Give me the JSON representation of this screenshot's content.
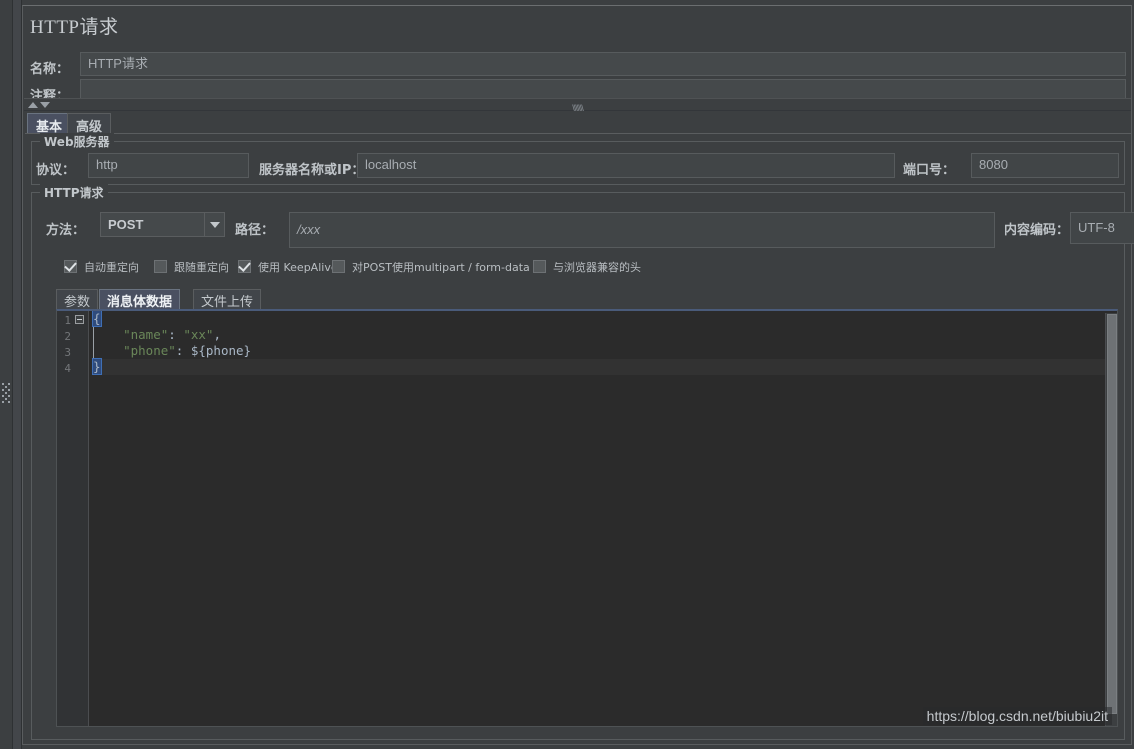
{
  "window": {
    "title": "HTTP请求"
  },
  "header": {
    "name_label": "名称：",
    "name_value": "HTTP请求",
    "comment_label": "注释：",
    "comment_value": ""
  },
  "tabs": [
    {
      "label": "基本",
      "selected": true
    },
    {
      "label": "高级",
      "selected": false
    }
  ],
  "web_server": {
    "group_label": "Web服务器",
    "protocol_label": "协议：",
    "protocol_value": "http",
    "server_label": "服务器名称或IP：",
    "server_value": "localhost",
    "port_label": "端口号：",
    "port_value": "8080"
  },
  "http_request": {
    "group_label": "HTTP请求",
    "method_label": "方法：",
    "method_value": "POST",
    "path_label": "路径：",
    "path_value": "/xxx",
    "encoding_label": "内容编码：",
    "encoding_value": "UTF-8",
    "checkboxes": [
      {
        "label": "自动重定向",
        "checked": true
      },
      {
        "label": "跟随重定向",
        "checked": false
      },
      {
        "label": "使用 KeepAlive",
        "checked": true
      },
      {
        "label": "对POST使用multipart / form-data",
        "checked": false
      },
      {
        "label": "与浏览器兼容的头",
        "checked": false
      }
    ],
    "inner_tabs": [
      {
        "label": "参数",
        "selected": false
      },
      {
        "label": "消息体数据",
        "selected": true
      },
      {
        "label": "文件上传",
        "selected": false
      }
    ]
  },
  "editor": {
    "line_numbers": [
      "1",
      "2",
      "3",
      "4"
    ],
    "lines": [
      {
        "tokens": [
          {
            "t": "{",
            "k": "brace"
          }
        ]
      },
      {
        "tokens": [
          {
            "t": "    ",
            "k": "plain"
          },
          {
            "t": "\"name\"",
            "k": "str"
          },
          {
            "t": ": ",
            "k": "plain"
          },
          {
            "t": "\"xx\"",
            "k": "strg"
          },
          {
            "t": ",",
            "k": "plain"
          }
        ]
      },
      {
        "tokens": [
          {
            "t": "    ",
            "k": "plain"
          },
          {
            "t": "\"phone\"",
            "k": "str"
          },
          {
            "t": ": ",
            "k": "plain"
          },
          {
            "t": "${phone}",
            "k": "plain"
          }
        ]
      },
      {
        "tokens": [
          {
            "t": "}",
            "k": "brace"
          }
        ]
      }
    ],
    "raw_text": "{\n    \"name\": \"xx\",\n    \"phone\": ${phone}\n}"
  },
  "watermark": {
    "text": "https://blog.csdn.net/biubiu2it"
  },
  "colors": {
    "panel_bg": "#3c3f41",
    "editor_bg": "#2b2b2b",
    "accent_tab": "#4a5061",
    "string_green": "#6a8759",
    "text": "#c8ccd0"
  }
}
